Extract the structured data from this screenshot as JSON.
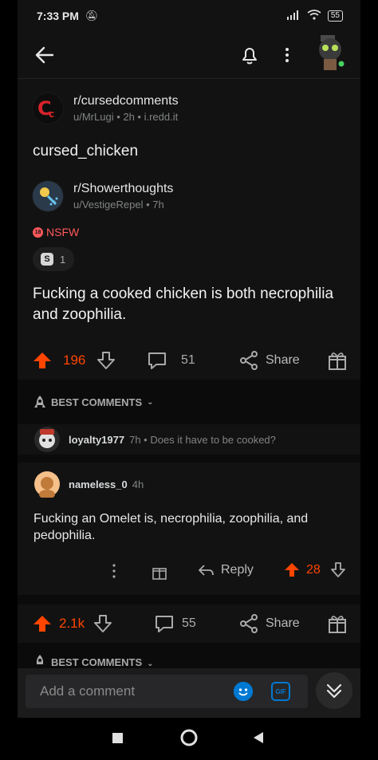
{
  "status": {
    "time": "7:33 PM",
    "battery": "55"
  },
  "post": {
    "subreddit": "r/cursedcomments",
    "meta": "u/MrLugi • 2h • i.redd.it",
    "title": "cursed_chicken",
    "crosspost_sub": "r/Showerthoughts",
    "crosspost_meta": "u/VestigeRepel • 7h",
    "nsfw_label": "NSFW",
    "nsfw_badge": "18",
    "award_count": "1",
    "award_glyph": "S",
    "body": "Fucking a cooked chicken is both necrophilia and zoophilia.",
    "votes": "196",
    "comments": "51",
    "share_label": "Share"
  },
  "section": {
    "best_comments": "BEST COMMENTS"
  },
  "collapsed_comment": {
    "user": "loyalty1977",
    "meta": "7h • Does it have to be cooked?"
  },
  "comment": {
    "user": "nameless_0",
    "meta": "4h",
    "text": "Fucking an Omelet is, necrophilia, zoophilia, and pedophilia.",
    "reply_label": "Reply",
    "votes": "28"
  },
  "second_post": {
    "votes": "2.1k",
    "comments": "55",
    "share_label": "Share"
  },
  "input": {
    "placeholder": "Add a comment",
    "gif_label": "GIF"
  },
  "colors": {
    "accent": "#ff4500",
    "nsfw": "#ff585b",
    "blue": "#0079d3",
    "bg": "#121212"
  }
}
